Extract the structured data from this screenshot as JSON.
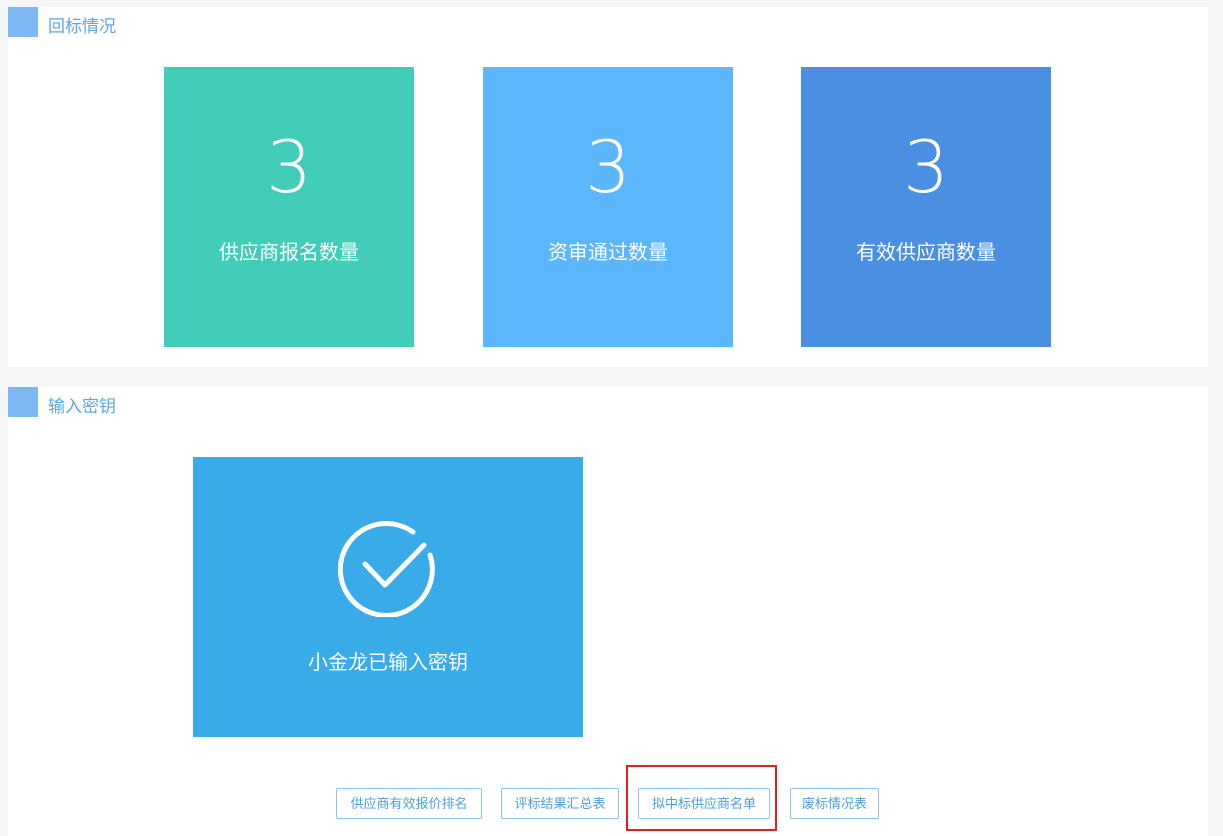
{
  "bid_return_section": {
    "title": "回标情况",
    "cards": [
      {
        "value": "3",
        "label": "供应商报名数量",
        "color": "#41cdb8"
      },
      {
        "value": "3",
        "label": "资审通过数量",
        "color": "#5bb6fc"
      },
      {
        "value": "3",
        "label": "有效供应商数量",
        "color": "#4a90e2"
      }
    ]
  },
  "key_section": {
    "title": "输入密钥",
    "status_label": "小金龙已输入密钥",
    "status_icon": "check-circle-icon",
    "card_color": "#38abe8"
  },
  "actions": [
    {
      "label": "供应商有效报价排名"
    },
    {
      "label": "评标结果汇总表"
    },
    {
      "label": "拟中标供应商名单"
    },
    {
      "label": "废标情况表"
    }
  ],
  "colors": {
    "accent": "#5aa6e8",
    "marker": "#7db7f6",
    "highlight": "#e02020"
  }
}
